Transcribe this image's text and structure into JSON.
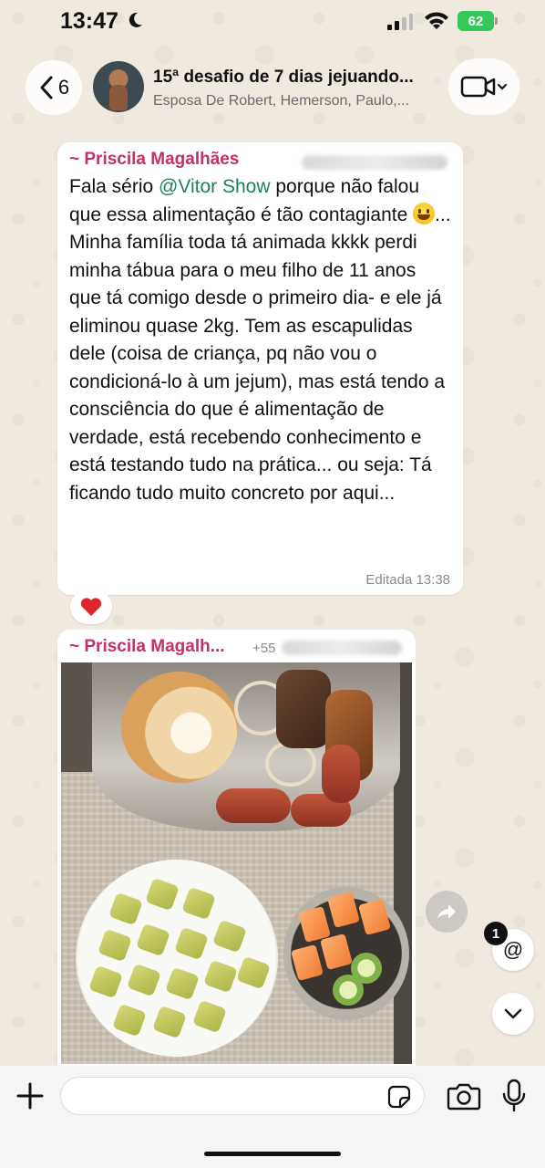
{
  "status_bar": {
    "time": "13:47",
    "battery": "62"
  },
  "header": {
    "back_count": "6",
    "title": "15ª desafio de 7 dias jejuando...",
    "subtitle": "Esposa De Robert, Hemerson, Paulo,..."
  },
  "messages": [
    {
      "sender": "~ Priscila Magalhães",
      "mention": "@Vitor Show",
      "text_before": "Fala sério ",
      "text_after_mention": " porque não falou que essa alimentação é tão contagiante ",
      "text_after_emoji": "... Minha família toda tá animada kkkk perdi minha tábua para o meu filho de 11 anos que tá comigo desde o primeiro dia- e ele já eliminou quase 2kg. Tem as escapulidas dele (coisa de criança, pq não vou o condicioná-lo à um jejum), mas está tendo a consciência do que é alimentação de verdade, está recebendo conhecimento e está testando tudo na prática... ou seja: Tá ficando tudo muito concreto por aqui...",
      "meta": "Editada 13:38",
      "reaction": "❤️"
    },
    {
      "sender": "~ Priscila Magalh...",
      "phone_fragment": "+55"
    }
  ],
  "floating": {
    "mention_count": "1",
    "mention_symbol": "@"
  },
  "composer": {
    "placeholder": "",
    "value": ""
  },
  "colors": {
    "sender": "#c1326a",
    "mention": "#1f7f5c",
    "battery": "#34c759"
  },
  "icons": [
    "moon-icon",
    "signal-icon",
    "wifi-icon",
    "back-chevron-icon",
    "video-call-icon",
    "heart-icon",
    "forward-icon",
    "chevron-down-icon",
    "plus-icon",
    "sticker-icon",
    "camera-icon",
    "microphone-icon"
  ]
}
